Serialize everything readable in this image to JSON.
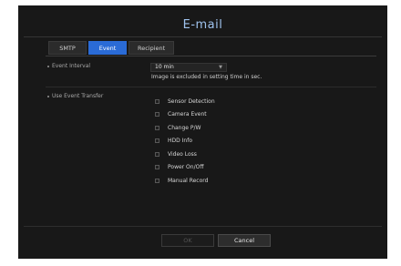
{
  "dialog": {
    "title": "E-mail",
    "tabs": [
      {
        "label": "SMTP",
        "active": false
      },
      {
        "label": "Event",
        "active": true
      },
      {
        "label": "Recipient",
        "active": false
      }
    ],
    "event_interval": {
      "label": "Event Interval",
      "value": "10 min",
      "note": "Image is excluded in setting time in sec."
    },
    "use_event_transfer": {
      "label": "Use Event Transfer",
      "options": [
        {
          "label": "Sensor Detection",
          "checked": false
        },
        {
          "label": "Camera Event",
          "checked": false
        },
        {
          "label": "Change P/W",
          "checked": false
        },
        {
          "label": "HDD Info",
          "checked": false
        },
        {
          "label": "Video Loss",
          "checked": false
        },
        {
          "label": "Power On/Off",
          "checked": false
        },
        {
          "label": "Manual Record",
          "checked": false
        }
      ]
    },
    "buttons": {
      "ok": "OK",
      "cancel": "Cancel"
    }
  },
  "colors": {
    "accent": "#2a6bd6",
    "title": "#9fc3ee",
    "panel_bg": "#181818"
  }
}
